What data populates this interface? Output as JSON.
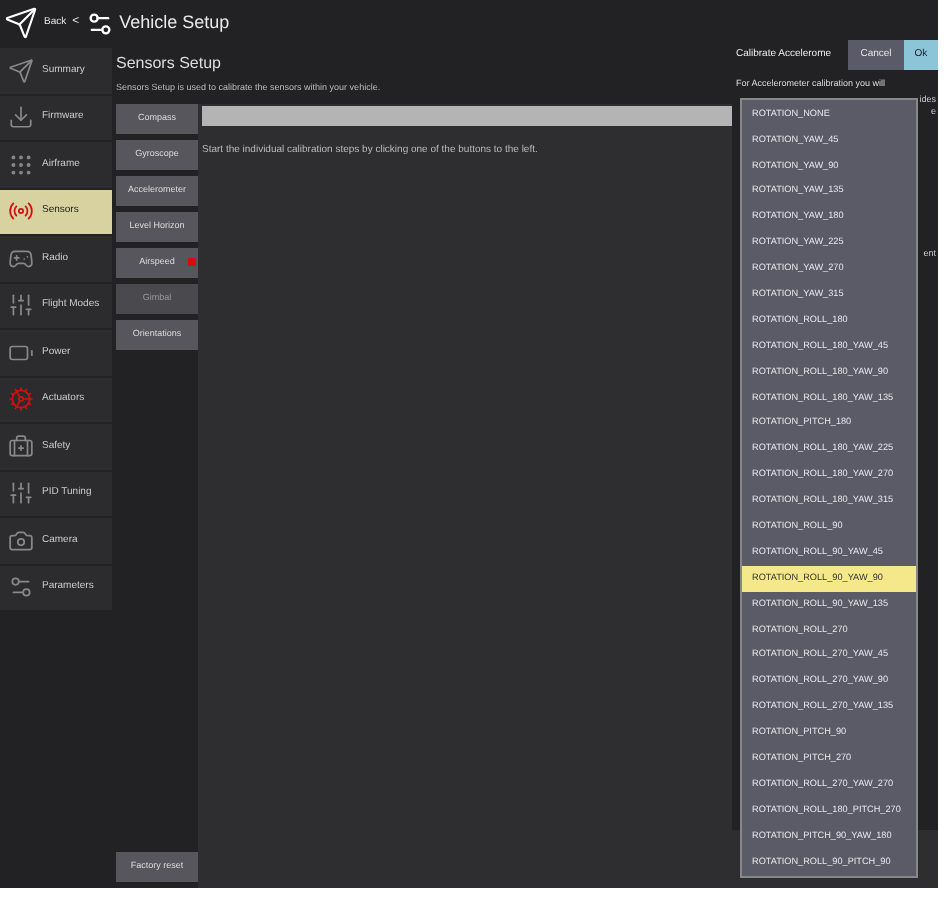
{
  "header": {
    "back": "Back",
    "back_arrow": "<",
    "title": "Vehicle Setup"
  },
  "sidebar": {
    "items": [
      {
        "label": "Summary",
        "selected": false
      },
      {
        "label": "Firmware",
        "selected": false
      },
      {
        "label": "Airframe",
        "selected": false
      },
      {
        "label": "Sensors",
        "selected": true
      },
      {
        "label": "Radio",
        "selected": false
      },
      {
        "label": "Flight Modes",
        "selected": false
      },
      {
        "label": "Power",
        "selected": false
      },
      {
        "label": "Actuators",
        "selected": false
      },
      {
        "label": "Safety",
        "selected": false
      },
      {
        "label": "PID Tuning",
        "selected": false
      },
      {
        "label": "Camera",
        "selected": false
      },
      {
        "label": "Parameters",
        "selected": false
      }
    ]
  },
  "page": {
    "title": "Sensors Setup",
    "description": "Sensors Setup is used to calibrate the sensors within your vehicle.",
    "instructions": "Start the individual calibration steps by clicking one of the buttons to the left.",
    "progress": {
      "level": 0
    }
  },
  "sensor_buttons": [
    {
      "label": "Compass",
      "disabled": false,
      "warning": false
    },
    {
      "label": "Gyroscope",
      "disabled": false,
      "warning": false
    },
    {
      "label": "Accelerometer",
      "disabled": false,
      "warning": false
    },
    {
      "label": "Level Horizon",
      "disabled": false,
      "warning": false
    },
    {
      "label": "Airspeed",
      "disabled": false,
      "warning": true
    },
    {
      "label": "Gimbal",
      "disabled": true,
      "warning": false
    },
    {
      "label": "Orientations",
      "disabled": false,
      "warning": false
    }
  ],
  "factory_reset": "Factory reset",
  "dialog": {
    "title": "Calibrate Accelerome",
    "buttons": [
      "Cancel",
      "Ok"
    ],
    "text": "For Accelerometer calibration you will",
    "fragments": [
      "ides",
      "e",
      "ent"
    ],
    "dropdown": [
      {
        "label": "ROTATION_NONE",
        "selected": false
      },
      {
        "label": "ROTATION_YAW_45",
        "selected": false
      },
      {
        "label": "ROTATION_YAW_90",
        "selected": false
      },
      {
        "label": "ROTATION_YAW_135",
        "selected": false
      },
      {
        "label": "ROTATION_YAW_180",
        "selected": false
      },
      {
        "label": "ROTATION_YAW_225",
        "selected": false
      },
      {
        "label": "ROTATION_YAW_270",
        "selected": false
      },
      {
        "label": "ROTATION_YAW_315",
        "selected": false
      },
      {
        "label": "ROTATION_ROLL_180",
        "selected": false
      },
      {
        "label": "ROTATION_ROLL_180_YAW_45",
        "selected": false
      },
      {
        "label": "ROTATION_ROLL_180_YAW_90",
        "selected": false
      },
      {
        "label": "ROTATION_ROLL_180_YAW_135",
        "selected": false
      },
      {
        "label": "ROTATION_PITCH_180",
        "selected": false
      },
      {
        "label": "ROTATION_ROLL_180_YAW_225",
        "selected": false
      },
      {
        "label": "ROTATION_ROLL_180_YAW_270",
        "selected": false
      },
      {
        "label": "ROTATION_ROLL_180_YAW_315",
        "selected": false
      },
      {
        "label": "ROTATION_ROLL_90",
        "selected": false
      },
      {
        "label": "ROTATION_ROLL_90_YAW_45",
        "selected": false
      },
      {
        "label": "ROTATION_ROLL_90_YAW_90",
        "selected": true
      },
      {
        "label": "ROTATION_ROLL_90_YAW_135",
        "selected": false
      },
      {
        "label": "ROTATION_ROLL_270",
        "selected": false
      },
      {
        "label": "ROTATION_ROLL_270_YAW_45",
        "selected": false
      },
      {
        "label": "ROTATION_ROLL_270_YAW_90",
        "selected": false
      },
      {
        "label": "ROTATION_ROLL_270_YAW_135",
        "selected": false
      },
      {
        "label": "ROTATION_PITCH_90",
        "selected": false
      },
      {
        "label": "ROTATION_PITCH_270",
        "selected": false
      },
      {
        "label": "ROTATION_ROLL_270_YAW_270",
        "selected": false
      },
      {
        "label": "ROTATION_ROLL_180_PITCH_270",
        "selected": false
      },
      {
        "label": "ROTATION_PITCH_90_YAW_180",
        "selected": false
      },
      {
        "label": "ROTATION_ROLL_90_PITCH_90",
        "selected": false
      }
    ]
  }
}
